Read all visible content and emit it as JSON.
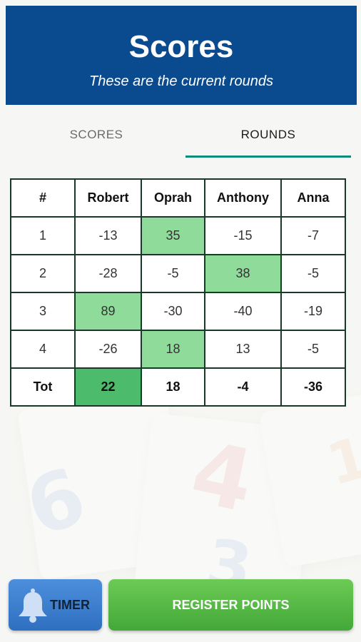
{
  "header": {
    "title": "Scores",
    "subtitle": "These are the current rounds"
  },
  "tabs": [
    {
      "label": "SCORES",
      "active": false
    },
    {
      "label": "ROUNDS",
      "active": true
    }
  ],
  "table": {
    "headers": [
      "#",
      "Robert",
      "Oprah",
      "Anthony",
      "Anna"
    ],
    "rows": [
      [
        "1",
        "-13",
        "35",
        "-15",
        "-7"
      ],
      [
        "2",
        "-28",
        "-5",
        "38",
        "-5"
      ],
      [
        "3",
        "89",
        "-30",
        "-40",
        "-19"
      ],
      [
        "4",
        "-26",
        "18",
        "13",
        "-5"
      ]
    ],
    "total": [
      "Tot",
      "22",
      "18",
      "-4",
      "-36"
    ]
  },
  "buttons": {
    "timer": "TIMER",
    "register": "REGISTER POINTS"
  },
  "colors": {
    "header_bg": "#0a4a8f",
    "tab_indicator": "#0f8a78",
    "round_winner": "#8fdb9a",
    "leader": "#4cbb6c",
    "timer_button": "#3a7ccc",
    "register_button": "#55b846"
  },
  "icons": {
    "timer": "bell-icon"
  }
}
